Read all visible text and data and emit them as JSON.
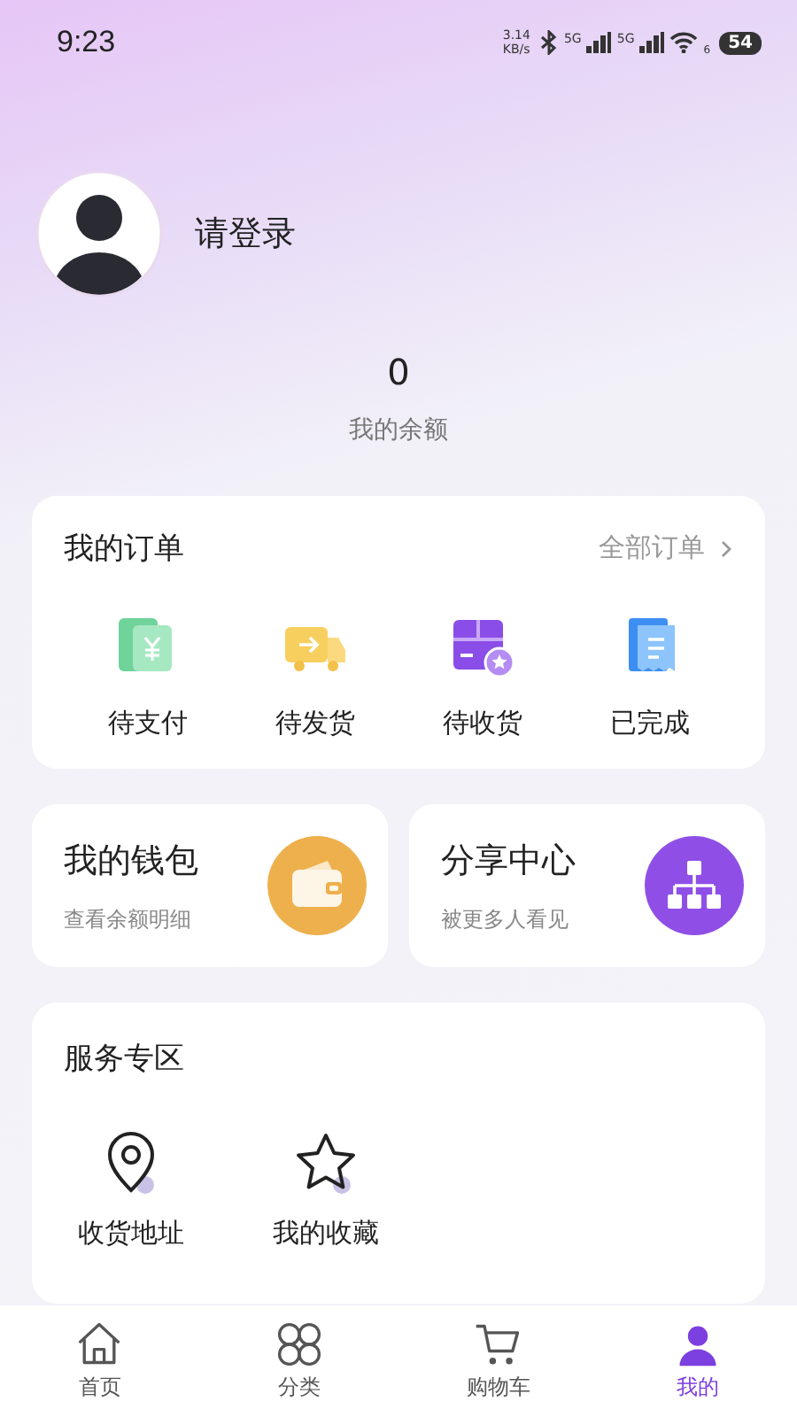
{
  "status_bar": {
    "time": "9:23",
    "net_speed": "3.14",
    "net_unit": "KB/s",
    "sim_1": "5G",
    "sim_2": "5G",
    "wifi_band": "6",
    "battery": "54"
  },
  "profile": {
    "login_label": "请登录"
  },
  "balance": {
    "value": "0",
    "label": "我的余额"
  },
  "orders": {
    "title": "我的订单",
    "all_link": "全部订单",
    "items": [
      {
        "label": "待支付",
        "kind": "pay"
      },
      {
        "label": "待发货",
        "kind": "ship"
      },
      {
        "label": "待收货",
        "kind": "receive"
      },
      {
        "label": "已完成",
        "kind": "done"
      }
    ]
  },
  "quick_cards": [
    {
      "title": "我的钱包",
      "subtitle": "查看余额明细",
      "kind": "wallet"
    },
    {
      "title": "分享中心",
      "subtitle": "被更多人看见",
      "kind": "share"
    }
  ],
  "services": {
    "title": "服务专区",
    "items": [
      {
        "label": "收货地址",
        "kind": "location"
      },
      {
        "label": "我的收藏",
        "kind": "favorite"
      }
    ]
  },
  "tab_bar": [
    {
      "label": "首页",
      "kind": "home",
      "selected": false
    },
    {
      "label": "分类",
      "kind": "category",
      "selected": false
    },
    {
      "label": "购物车",
      "kind": "cart",
      "selected": false
    },
    {
      "label": "我的",
      "kind": "me",
      "selected": true
    }
  ]
}
